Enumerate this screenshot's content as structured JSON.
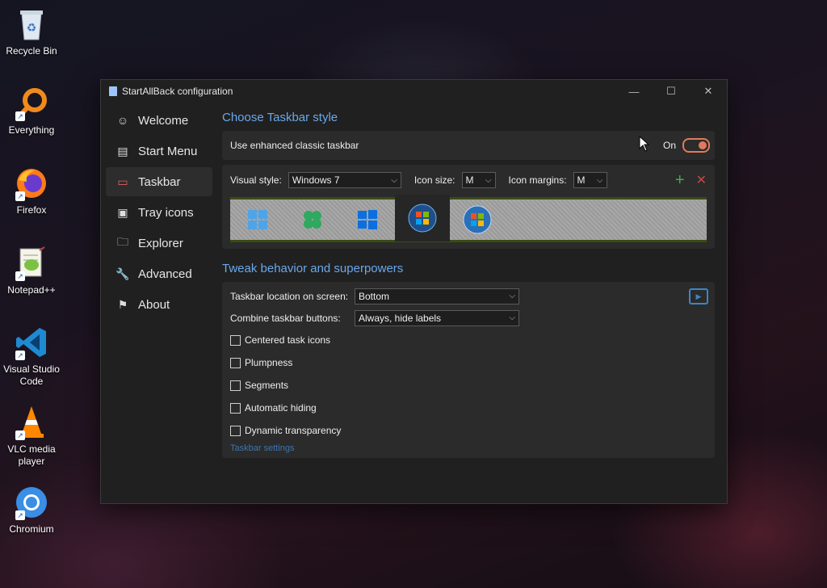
{
  "desktop": {
    "icons": [
      {
        "label": "Recycle Bin",
        "icon": "recycle-bin-icon"
      },
      {
        "label": "Everything",
        "icon": "magnifier-icon"
      },
      {
        "label": "Firefox",
        "icon": "firefox-icon"
      },
      {
        "label": "Notepad++",
        "icon": "notepad-plus-plus-icon"
      },
      {
        "label": "Visual Studio Code",
        "icon": "vscode-icon"
      },
      {
        "label": "VLC media player",
        "icon": "vlc-cone-icon"
      },
      {
        "label": "Chromium",
        "icon": "chromium-icon"
      }
    ]
  },
  "window": {
    "title": "StartAllBack configuration",
    "controls": {
      "minimize": "—",
      "maximize": "☐",
      "close": "✕"
    }
  },
  "sidebar": {
    "items": [
      {
        "label": "Welcome",
        "icon": "smiley-icon",
        "active": false
      },
      {
        "label": "Start Menu",
        "icon": "start-menu-icon",
        "active": false
      },
      {
        "label": "Taskbar",
        "icon": "taskbar-icon",
        "active": true
      },
      {
        "label": "Tray icons",
        "icon": "tray-icon",
        "active": false
      },
      {
        "label": "Explorer",
        "icon": "folder-icon",
        "active": false
      },
      {
        "label": "Advanced",
        "icon": "wrench-icon",
        "active": false
      },
      {
        "label": "About",
        "icon": "about-icon",
        "active": false
      }
    ]
  },
  "taskbar_style": {
    "heading": "Choose Taskbar style",
    "enhanced_label": "Use enhanced classic taskbar",
    "toggle_state": "On",
    "visual_style_label": "Visual style:",
    "visual_style_value": "Windows 7",
    "icon_size_label": "Icon size:",
    "icon_size_value": "M",
    "icon_margins_label": "Icon margins:",
    "icon_margins_value": "M",
    "add_symbol": "+",
    "remove_symbol": "✕",
    "preview_styles": [
      "windows-11-start-icon",
      "green-clover-start-icon",
      "windows-10-start-icon",
      "windows-7-orb-icon",
      "windows-vista-orb-icon"
    ],
    "selected_preview": "windows-7-orb-icon"
  },
  "tweaks": {
    "heading": "Tweak behavior and superpowers",
    "location_label": "Taskbar location on screen:",
    "location_value": "Bottom",
    "combine_label": "Combine taskbar buttons:",
    "combine_value": "Always, hide labels",
    "checkboxes": [
      {
        "label": "Centered task icons",
        "checked": false
      },
      {
        "label": "Plumpness",
        "checked": false
      },
      {
        "label": "Segments",
        "checked": false
      },
      {
        "label": "Automatic hiding",
        "checked": false
      },
      {
        "label": "Dynamic transparency",
        "checked": false
      }
    ],
    "settings_link": "Taskbar settings"
  },
  "colors": {
    "accent_blue": "#6aa8ea",
    "toggle_orange": "#e07a5f",
    "active_nav_red": "#e06060",
    "add_green": "#3cb04a",
    "remove_red": "#c04a4a"
  }
}
